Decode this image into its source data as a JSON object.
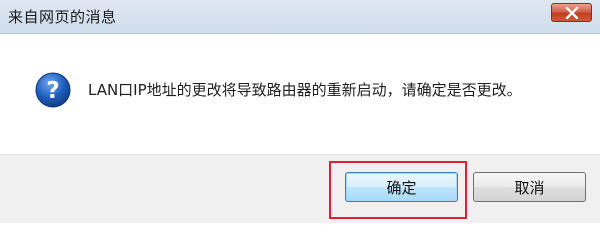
{
  "window": {
    "title": "来自网页的消息",
    "close_icon": "close-icon"
  },
  "message": {
    "icon": "question-icon",
    "text": "LAN口IP地址的更改将导致路由器的重新启动，请确定是否更改。"
  },
  "buttons": {
    "ok_label": "确定",
    "cancel_label": "取消"
  },
  "colors": {
    "highlight_frame": "#d9232d",
    "close_button": "#c23d22",
    "icon_blue": "#1f5fbf"
  }
}
